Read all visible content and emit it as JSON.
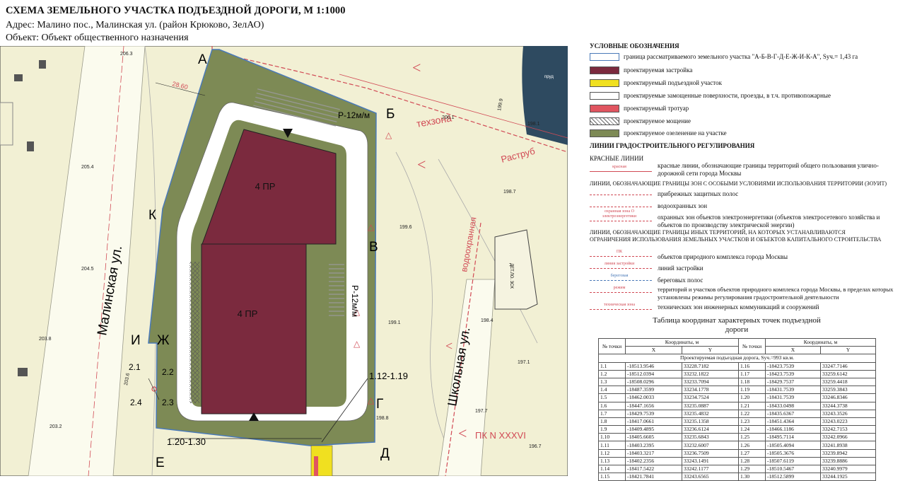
{
  "header": {
    "title": "СХЕМА ЗЕМЕЛЬНОГО УЧАСТКА ПОДЪЕЗДНОЙ ДОРОГИ, М 1:1000",
    "address": "Адрес:  Малино пос., Малинская ул. (район Крюково, ЗелАО)",
    "object": "Объект: Объект общественного назначения"
  },
  "map": {
    "point_labels": {
      "a": "А",
      "b": "Б",
      "v": "В",
      "g": "Г",
      "d": "Д",
      "e": "Е",
      "zh": "Ж",
      "i": "И",
      "k": "К"
    },
    "streets": {
      "malinskaya": "Малинская ул.",
      "shkolnaya": "Школьная ул."
    },
    "buildings": {
      "north": "4 ПР",
      "south": "4 ПР"
    },
    "roads": {
      "r1": "Р-12м/м",
      "r2": "Р-12м/м"
    },
    "ranges": {
      "top": "1.12-1.19",
      "bottom": "1.20-1.30"
    },
    "points": {
      "p21": "2.1",
      "p22": "2.2",
      "p23": "2.3",
      "p24": "2.4"
    },
    "elevations": [
      "206.3",
      "205.4",
      "204.5",
      "203.8",
      "203.6",
      "203.2",
      "200.1",
      "199.9",
      "199.6",
      "199.1",
      "198.8",
      "198.7",
      "198.4",
      "198.1",
      "197.7",
      "197.1",
      "196.7"
    ],
    "red_labels": {
      "techzona": "техзона",
      "vodo": "водоохранная",
      "rastrub": "Раструб",
      "pk": "ПК N XXXVI"
    },
    "misc": {
      "dim": "28.60",
      "pond": "пруд",
      "dsk": "ДЕТ.ЛО. 3СК"
    },
    "colors": {
      "green": "#7d8a55",
      "building": "#7b2a3e",
      "paving": "#ffffff",
      "road": "#f0e020",
      "base": "#f2f0d4",
      "water": "#2e4a60"
    }
  },
  "legend": {
    "title": "УСЛОВНЫЕ ОБОЗНАЧЕНИЯ",
    "items": [
      {
        "text": "граница рассматриваемого земельного участка \"А-Б-В-Г-Д-Е-Ж-И-К-А\", Sуч.= 1,43 га",
        "color": "#ffffff",
        "border": "#4a7ab8"
      },
      {
        "text": "проектируемая застройка",
        "color": "#7b2a3e",
        "border": "#555"
      },
      {
        "text": "проектируемый подъездной участок",
        "color": "#f0e020",
        "border": "#555"
      },
      {
        "text": "проектируемые замощенные поверхности, проезды, в т.ч. противопожарные",
        "color": "#ffffff",
        "border": "#555"
      },
      {
        "text": "проектируемый тротуар",
        "color": "#e05560",
        "border": "#555"
      },
      {
        "text": "проектируемое мощение",
        "color": "hatch",
        "border": "#555"
      },
      {
        "text": "проектируемое озеленение на участке",
        "color": "#7d8a55",
        "border": "#555"
      }
    ],
    "section2": "ЛИНИИ ГРАДОСТРОИТЕЛЬНОГО РЕГУЛИРОВАНИЯ",
    "red_lines_title": "КРАСНЫЕ ЛИНИИ",
    "red_line_label": "красная",
    "red_line_text": "красные линии, обозначающие границы территорий общего пользования улично-дорожной сети города Москвы",
    "zouit_title": "ЛИНИИ, ОБОЗНАЧАЮЩИЕ ГРАНИЦЫ ЗОН С ОСОБЫМИ УСЛОВИЯМИ ИСПОЛЬЗОВАНИЯ ТЕРРИТОРИИ (ЗОУИТ)",
    "zouit_items": [
      {
        "label": "",
        "text": "прибрежных защитных полос"
      },
      {
        "label": "",
        "text": "водоохранных зон"
      },
      {
        "label": "охранная зона О электроэнергетики",
        "text": "охранных зон объектов электроэнергетики (объектов электросетевого хозяйства и объектов по производству электрической энергии)"
      }
    ],
    "other_title": "ЛИНИИ, ОБОЗНАЧАЮЩИЕ ГРАНИЦЫ ИНЫХ ТЕРРИТОРИЙ, НА КОТОРЫХ УСТАНАВЛИВАЮТСЯ ОГРАНИЧЕНИЯ ИСПОЛЬЗОВАНИЯ ЗЕМЕЛЬНЫХ УЧАСТКОВ И ОБЪЕКТОВ КАПИТАЛЬНОГО СТРОИТЕЛЬСТВА",
    "other_items": [
      {
        "label": "ПК",
        "text": "объектов природного комплекса города Москвы"
      },
      {
        "label": "линия застройки",
        "text": "линий застройки"
      },
      {
        "label": "береговая",
        "text": "береговых полос"
      },
      {
        "label": "режим",
        "text": "территорий и участков объектов природного комплекса города Москвы, в пределах которых установлены режимы регулирования градостроительной деятельности"
      },
      {
        "label": "техническая зона",
        "text": "технических зон инженерных коммуникаций и сооружений"
      }
    ]
  },
  "coord_table": {
    "title": "Таблица координат характерных точек подъездной дороги",
    "col_no": "№ точки",
    "col_coords": "Координаты, м",
    "col_x": "X",
    "col_y": "Y",
    "section_row": "Проектируемая подъездная дорога, Sуч.=993 кв.м.",
    "rows": [
      [
        "1.1",
        "-18513.9546",
        "33228.7182",
        "1.16",
        "-18423.7539",
        "33247.7146"
      ],
      [
        "1.2",
        "-18512.0394",
        "33232.1822",
        "1.17",
        "-18423.7539",
        "33259.6142"
      ],
      [
        "1.3",
        "-18508.0296",
        "33233.7094",
        "1.18",
        "-18429.7537",
        "33259.4418"
      ],
      [
        "1.4",
        "-18487.3599",
        "33234.1778",
        "1.19",
        "-18431.7539",
        "33259.3843"
      ],
      [
        "1.5",
        "-18462.0033",
        "33234.7524",
        "1.20",
        "-18431.7539",
        "33246.8346"
      ],
      [
        "1.6",
        "-18447.1656",
        "33235.0887",
        "1.21",
        "-18433.0498",
        "33244.3738"
      ],
      [
        "1.7",
        "-18429.7539",
        "33235.4832",
        "1.22",
        "-18435.6367",
        "33243.3526"
      ],
      [
        "1.8",
        "-18417.0661",
        "33235.1358",
        "1.23",
        "-18451.4364",
        "33243.0223"
      ],
      [
        "1.9",
        "-18409.4895",
        "33236.6124",
        "1.24",
        "-18466.1186",
        "33242.7153"
      ],
      [
        "1.10",
        "-18405.6605",
        "33235.6843",
        "1.25",
        "-18495.7114",
        "33242.0966"
      ],
      [
        "1.11",
        "-18403.2395",
        "33232.6007",
        "1.26",
        "-18505.4094",
        "33241.8938"
      ],
      [
        "1.12",
        "-18403.3217",
        "33236.7509",
        "1.27",
        "-18505.3676",
        "33239.8942"
      ],
      [
        "1.13",
        "-18402.2356",
        "33243.1491",
        "1.28",
        "-18507.6119",
        "33239.8886"
      ],
      [
        "1.14",
        "-18417.5422",
        "33242.1177",
        "1.29",
        "-18510.5467",
        "33240.9979"
      ],
      [
        "1.15",
        "-18421.7841",
        "33243.6565",
        "1.30",
        "-18512.5899",
        "33244.1925"
      ]
    ]
  }
}
